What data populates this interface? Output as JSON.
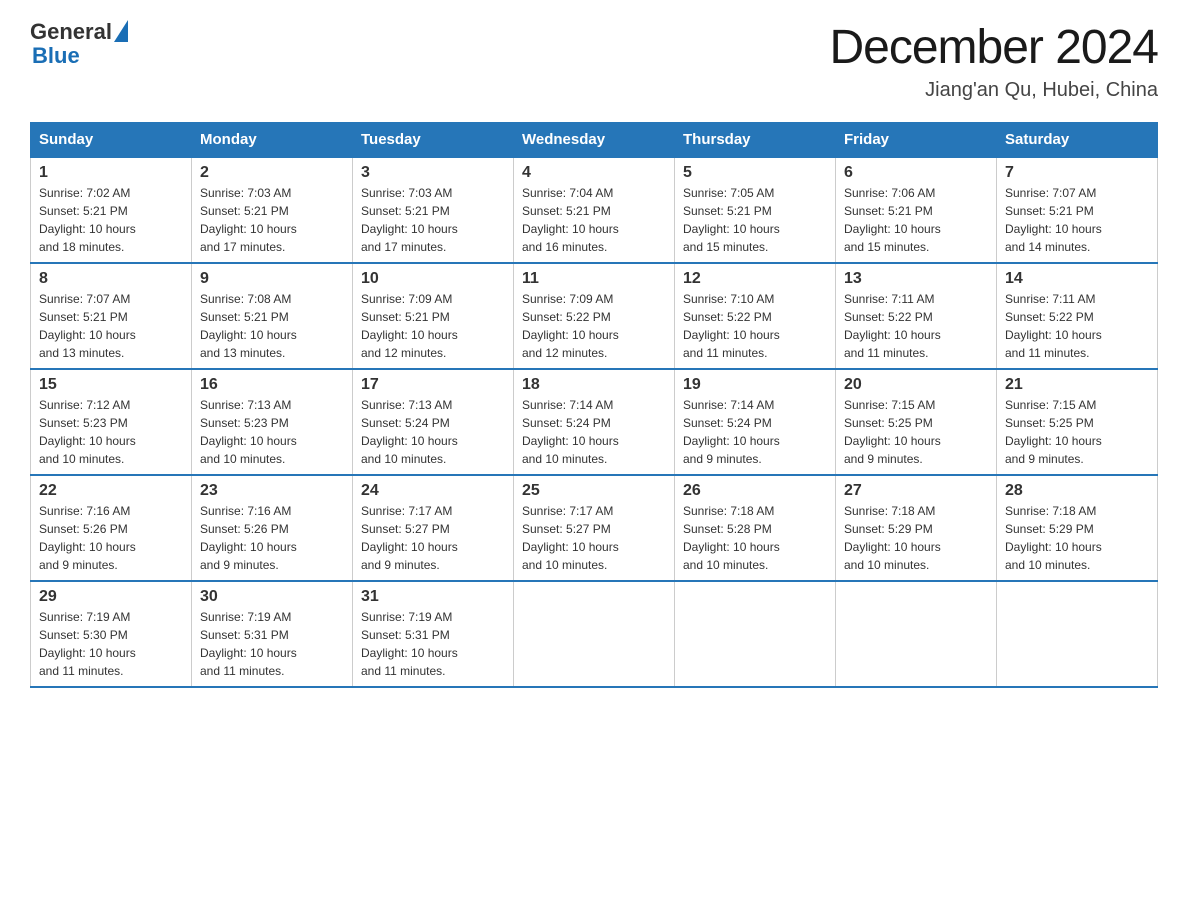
{
  "header": {
    "logo_general": "General",
    "logo_blue": "Blue",
    "title": "December 2024",
    "location": "Jiang'an Qu, Hubei, China"
  },
  "days_of_week": [
    "Sunday",
    "Monday",
    "Tuesday",
    "Wednesday",
    "Thursday",
    "Friday",
    "Saturday"
  ],
  "weeks": [
    [
      {
        "day": "1",
        "sunrise": "7:02 AM",
        "sunset": "5:21 PM",
        "daylight": "10 hours and 18 minutes."
      },
      {
        "day": "2",
        "sunrise": "7:03 AM",
        "sunset": "5:21 PM",
        "daylight": "10 hours and 17 minutes."
      },
      {
        "day": "3",
        "sunrise": "7:03 AM",
        "sunset": "5:21 PM",
        "daylight": "10 hours and 17 minutes."
      },
      {
        "day": "4",
        "sunrise": "7:04 AM",
        "sunset": "5:21 PM",
        "daylight": "10 hours and 16 minutes."
      },
      {
        "day": "5",
        "sunrise": "7:05 AM",
        "sunset": "5:21 PM",
        "daylight": "10 hours and 15 minutes."
      },
      {
        "day": "6",
        "sunrise": "7:06 AM",
        "sunset": "5:21 PM",
        "daylight": "10 hours and 15 minutes."
      },
      {
        "day": "7",
        "sunrise": "7:07 AM",
        "sunset": "5:21 PM",
        "daylight": "10 hours and 14 minutes."
      }
    ],
    [
      {
        "day": "8",
        "sunrise": "7:07 AM",
        "sunset": "5:21 PM",
        "daylight": "10 hours and 13 minutes."
      },
      {
        "day": "9",
        "sunrise": "7:08 AM",
        "sunset": "5:21 PM",
        "daylight": "10 hours and 13 minutes."
      },
      {
        "day": "10",
        "sunrise": "7:09 AM",
        "sunset": "5:21 PM",
        "daylight": "10 hours and 12 minutes."
      },
      {
        "day": "11",
        "sunrise": "7:09 AM",
        "sunset": "5:22 PM",
        "daylight": "10 hours and 12 minutes."
      },
      {
        "day": "12",
        "sunrise": "7:10 AM",
        "sunset": "5:22 PM",
        "daylight": "10 hours and 11 minutes."
      },
      {
        "day": "13",
        "sunrise": "7:11 AM",
        "sunset": "5:22 PM",
        "daylight": "10 hours and 11 minutes."
      },
      {
        "day": "14",
        "sunrise": "7:11 AM",
        "sunset": "5:22 PM",
        "daylight": "10 hours and 11 minutes."
      }
    ],
    [
      {
        "day": "15",
        "sunrise": "7:12 AM",
        "sunset": "5:23 PM",
        "daylight": "10 hours and 10 minutes."
      },
      {
        "day": "16",
        "sunrise": "7:13 AM",
        "sunset": "5:23 PM",
        "daylight": "10 hours and 10 minutes."
      },
      {
        "day": "17",
        "sunrise": "7:13 AM",
        "sunset": "5:24 PM",
        "daylight": "10 hours and 10 minutes."
      },
      {
        "day": "18",
        "sunrise": "7:14 AM",
        "sunset": "5:24 PM",
        "daylight": "10 hours and 10 minutes."
      },
      {
        "day": "19",
        "sunrise": "7:14 AM",
        "sunset": "5:24 PM",
        "daylight": "10 hours and 9 minutes."
      },
      {
        "day": "20",
        "sunrise": "7:15 AM",
        "sunset": "5:25 PM",
        "daylight": "10 hours and 9 minutes."
      },
      {
        "day": "21",
        "sunrise": "7:15 AM",
        "sunset": "5:25 PM",
        "daylight": "10 hours and 9 minutes."
      }
    ],
    [
      {
        "day": "22",
        "sunrise": "7:16 AM",
        "sunset": "5:26 PM",
        "daylight": "10 hours and 9 minutes."
      },
      {
        "day": "23",
        "sunrise": "7:16 AM",
        "sunset": "5:26 PM",
        "daylight": "10 hours and 9 minutes."
      },
      {
        "day": "24",
        "sunrise": "7:17 AM",
        "sunset": "5:27 PM",
        "daylight": "10 hours and 9 minutes."
      },
      {
        "day": "25",
        "sunrise": "7:17 AM",
        "sunset": "5:27 PM",
        "daylight": "10 hours and 10 minutes."
      },
      {
        "day": "26",
        "sunrise": "7:18 AM",
        "sunset": "5:28 PM",
        "daylight": "10 hours and 10 minutes."
      },
      {
        "day": "27",
        "sunrise": "7:18 AM",
        "sunset": "5:29 PM",
        "daylight": "10 hours and 10 minutes."
      },
      {
        "day": "28",
        "sunrise": "7:18 AM",
        "sunset": "5:29 PM",
        "daylight": "10 hours and 10 minutes."
      }
    ],
    [
      {
        "day": "29",
        "sunrise": "7:19 AM",
        "sunset": "5:30 PM",
        "daylight": "10 hours and 11 minutes."
      },
      {
        "day": "30",
        "sunrise": "7:19 AM",
        "sunset": "5:31 PM",
        "daylight": "10 hours and 11 minutes."
      },
      {
        "day": "31",
        "sunrise": "7:19 AM",
        "sunset": "5:31 PM",
        "daylight": "10 hours and 11 minutes."
      },
      null,
      null,
      null,
      null
    ]
  ],
  "labels": {
    "sunrise": "Sunrise:",
    "sunset": "Sunset:",
    "daylight": "Daylight:"
  }
}
